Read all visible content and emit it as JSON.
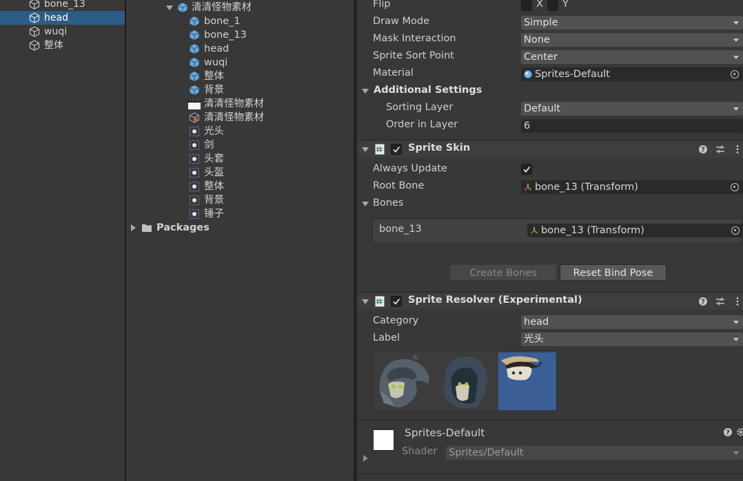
{
  "hierarchy": {
    "items": [
      {
        "label": "bone_13"
      },
      {
        "label": "head"
      },
      {
        "label": "wuqi"
      },
      {
        "label": "整体"
      }
    ]
  },
  "project": {
    "root_folder": "清清怪物素材",
    "children": [
      {
        "label": "bone_1"
      },
      {
        "label": "bone_13"
      },
      {
        "label": "head"
      },
      {
        "label": "wuqi"
      },
      {
        "label": "整体"
      },
      {
        "label": "背景"
      },
      {
        "label": "清清怪物素材"
      },
      {
        "label": "清清怪物素材"
      },
      {
        "label": "光头"
      },
      {
        "label": "剑"
      },
      {
        "label": "头套"
      },
      {
        "label": "头盔"
      },
      {
        "label": "整体"
      },
      {
        "label": "背景"
      },
      {
        "label": "锤子"
      }
    ],
    "packages_label": "Packages"
  },
  "inspector": {
    "flip": {
      "label": "Flip",
      "x": "X",
      "y": "Y"
    },
    "draw_mode": {
      "label": "Draw Mode",
      "value": "Simple"
    },
    "mask_interaction": {
      "label": "Mask Interaction",
      "value": "None"
    },
    "sprite_sort_point": {
      "label": "Sprite Sort Point",
      "value": "Center"
    },
    "material": {
      "label": "Material",
      "value": "Sprites-Default"
    },
    "additional_settings": {
      "title": "Additional Settings",
      "sorting_layer": {
        "label": "Sorting Layer",
        "value": "Default"
      },
      "order_in_layer": {
        "label": "Order in Layer",
        "value": "6"
      }
    },
    "sprite_skin": {
      "title": "Sprite Skin",
      "always_update": {
        "label": "Always Update",
        "checked": true
      },
      "root_bone": {
        "label": "Root Bone",
        "value": "bone_13 (Transform)"
      },
      "bones_label": "Bones",
      "bone_row": {
        "name": "bone_13",
        "value": "bone_13 (Transform)"
      },
      "create_bones_label": "Create Bones",
      "reset_bind_pose_label": "Reset Bind Pose"
    },
    "sprite_resolver": {
      "title": "Sprite Resolver (Experimental)",
      "category": {
        "label": "Category",
        "value": "head"
      },
      "label": {
        "label": "Label",
        "value": "光头"
      }
    },
    "material_preview": {
      "name": "Sprites-Default",
      "shader_label": "Shader",
      "shader_value": "Sprites/Default"
    }
  },
  "colors": {
    "selection": "#2c5d87",
    "panel_bg": "#383838",
    "field_bg": "#2a2a2a",
    "dropdown_bg": "#515151",
    "thumb_selected_bg": "#3a5e96"
  },
  "icons": {
    "gameobject": "cube-outline-icon",
    "prefab": "prefab-cube-icon",
    "sprite": "sprite-icon",
    "folder": "folder-icon",
    "bone": "bone-transform-icon",
    "material": "material-sphere-icon",
    "script": "script-icon",
    "help": "help-icon",
    "presets": "presets-icon",
    "menu": "kebab-menu-icon"
  }
}
